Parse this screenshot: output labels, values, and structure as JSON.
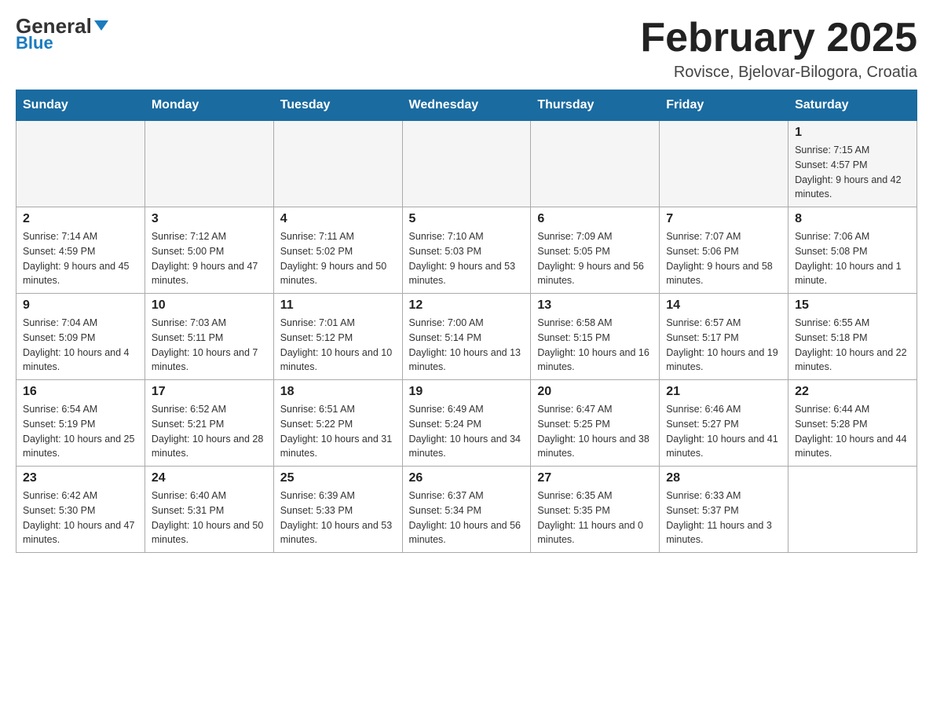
{
  "header": {
    "logo_main": "General",
    "logo_sub": "Blue",
    "month_title": "February 2025",
    "location": "Rovisce, Bjelovar-Bilogora, Croatia"
  },
  "weekdays": [
    "Sunday",
    "Monday",
    "Tuesday",
    "Wednesday",
    "Thursday",
    "Friday",
    "Saturday"
  ],
  "weeks": [
    [
      {
        "day": "",
        "info": ""
      },
      {
        "day": "",
        "info": ""
      },
      {
        "day": "",
        "info": ""
      },
      {
        "day": "",
        "info": ""
      },
      {
        "day": "",
        "info": ""
      },
      {
        "day": "",
        "info": ""
      },
      {
        "day": "1",
        "info": "Sunrise: 7:15 AM\nSunset: 4:57 PM\nDaylight: 9 hours and 42 minutes."
      }
    ],
    [
      {
        "day": "2",
        "info": "Sunrise: 7:14 AM\nSunset: 4:59 PM\nDaylight: 9 hours and 45 minutes."
      },
      {
        "day": "3",
        "info": "Sunrise: 7:12 AM\nSunset: 5:00 PM\nDaylight: 9 hours and 47 minutes."
      },
      {
        "day": "4",
        "info": "Sunrise: 7:11 AM\nSunset: 5:02 PM\nDaylight: 9 hours and 50 minutes."
      },
      {
        "day": "5",
        "info": "Sunrise: 7:10 AM\nSunset: 5:03 PM\nDaylight: 9 hours and 53 minutes."
      },
      {
        "day": "6",
        "info": "Sunrise: 7:09 AM\nSunset: 5:05 PM\nDaylight: 9 hours and 56 minutes."
      },
      {
        "day": "7",
        "info": "Sunrise: 7:07 AM\nSunset: 5:06 PM\nDaylight: 9 hours and 58 minutes."
      },
      {
        "day": "8",
        "info": "Sunrise: 7:06 AM\nSunset: 5:08 PM\nDaylight: 10 hours and 1 minute."
      }
    ],
    [
      {
        "day": "9",
        "info": "Sunrise: 7:04 AM\nSunset: 5:09 PM\nDaylight: 10 hours and 4 minutes."
      },
      {
        "day": "10",
        "info": "Sunrise: 7:03 AM\nSunset: 5:11 PM\nDaylight: 10 hours and 7 minutes."
      },
      {
        "day": "11",
        "info": "Sunrise: 7:01 AM\nSunset: 5:12 PM\nDaylight: 10 hours and 10 minutes."
      },
      {
        "day": "12",
        "info": "Sunrise: 7:00 AM\nSunset: 5:14 PM\nDaylight: 10 hours and 13 minutes."
      },
      {
        "day": "13",
        "info": "Sunrise: 6:58 AM\nSunset: 5:15 PM\nDaylight: 10 hours and 16 minutes."
      },
      {
        "day": "14",
        "info": "Sunrise: 6:57 AM\nSunset: 5:17 PM\nDaylight: 10 hours and 19 minutes."
      },
      {
        "day": "15",
        "info": "Sunrise: 6:55 AM\nSunset: 5:18 PM\nDaylight: 10 hours and 22 minutes."
      }
    ],
    [
      {
        "day": "16",
        "info": "Sunrise: 6:54 AM\nSunset: 5:19 PM\nDaylight: 10 hours and 25 minutes."
      },
      {
        "day": "17",
        "info": "Sunrise: 6:52 AM\nSunset: 5:21 PM\nDaylight: 10 hours and 28 minutes."
      },
      {
        "day": "18",
        "info": "Sunrise: 6:51 AM\nSunset: 5:22 PM\nDaylight: 10 hours and 31 minutes."
      },
      {
        "day": "19",
        "info": "Sunrise: 6:49 AM\nSunset: 5:24 PM\nDaylight: 10 hours and 34 minutes."
      },
      {
        "day": "20",
        "info": "Sunrise: 6:47 AM\nSunset: 5:25 PM\nDaylight: 10 hours and 38 minutes."
      },
      {
        "day": "21",
        "info": "Sunrise: 6:46 AM\nSunset: 5:27 PM\nDaylight: 10 hours and 41 minutes."
      },
      {
        "day": "22",
        "info": "Sunrise: 6:44 AM\nSunset: 5:28 PM\nDaylight: 10 hours and 44 minutes."
      }
    ],
    [
      {
        "day": "23",
        "info": "Sunrise: 6:42 AM\nSunset: 5:30 PM\nDaylight: 10 hours and 47 minutes."
      },
      {
        "day": "24",
        "info": "Sunrise: 6:40 AM\nSunset: 5:31 PM\nDaylight: 10 hours and 50 minutes."
      },
      {
        "day": "25",
        "info": "Sunrise: 6:39 AM\nSunset: 5:33 PM\nDaylight: 10 hours and 53 minutes."
      },
      {
        "day": "26",
        "info": "Sunrise: 6:37 AM\nSunset: 5:34 PM\nDaylight: 10 hours and 56 minutes."
      },
      {
        "day": "27",
        "info": "Sunrise: 6:35 AM\nSunset: 5:35 PM\nDaylight: 11 hours and 0 minutes."
      },
      {
        "day": "28",
        "info": "Sunrise: 6:33 AM\nSunset: 5:37 PM\nDaylight: 11 hours and 3 minutes."
      },
      {
        "day": "",
        "info": ""
      }
    ]
  ]
}
